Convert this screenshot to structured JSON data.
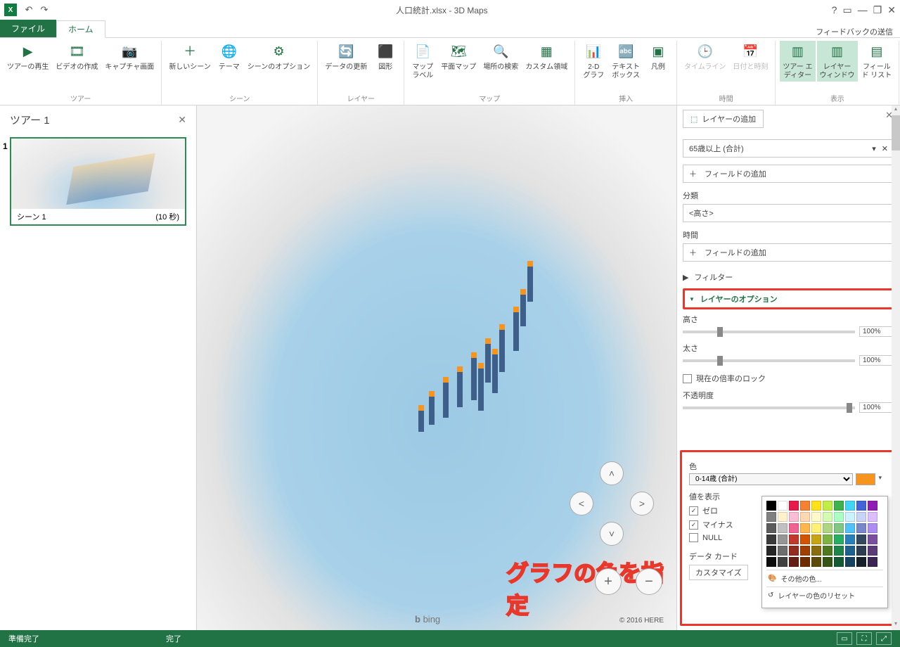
{
  "title": "人口統計.xlsx - 3D Maps",
  "qat": {
    "undo": "↶",
    "redo": "↷"
  },
  "winctrls": {
    "help": "?",
    "opts": "▭",
    "min": "—",
    "restore": "❐",
    "close": "✕"
  },
  "tabs": {
    "file": "ファイル",
    "home": "ホーム"
  },
  "feedback": "フィードバックの送信",
  "ribbon": {
    "tour": {
      "label": "ツアー",
      "play": "ツアーの再生",
      "video": "ビデオの作成",
      "capture": "キャプチャ画面"
    },
    "scene": {
      "label": "シーン",
      "newscene": "新しいシーン",
      "theme": "テーマ",
      "options": "シーンのオプション"
    },
    "layer": {
      "label": "レイヤー",
      "refresh": "データの更新",
      "shape": "図形"
    },
    "map": {
      "label": "マップ",
      "labels": "マップ\nラベル",
      "flat": "平面マップ",
      "find": "場所の検索",
      "custom": "カスタム領域"
    },
    "insert": {
      "label": "挿入",
      "chart2d": "2-D\nグラフ",
      "textbox": "テキスト\nボックス",
      "legend": "凡例"
    },
    "time": {
      "label": "時間",
      "timeline": "タイムライン",
      "datetime": "日付と時刻"
    },
    "view": {
      "label": "表示",
      "toureditor": "ツアー エ\nディター",
      "layerwin": "レイヤー\nウィンドウ",
      "fieldlist": "フィール\nド リスト"
    }
  },
  "tourpanel": {
    "title": "ツアー 1",
    "scene_idx": "1",
    "scene_name": "シーン 1",
    "scene_dur": "(10 秒)"
  },
  "map": {
    "bing": "bing",
    "copyright": "© 2016 HERE"
  },
  "callout": "グラフの色を指定",
  "side": {
    "add_layer": "レイヤーの追加",
    "height_field": "65歳以上 (合計)",
    "add_field": "フィールドの追加",
    "category": "分類",
    "category_val": "<高さ>",
    "time": "時間",
    "filter": "フィルター",
    "layer_opts": "レイヤーのオプション",
    "height": "高さ",
    "height_val": "100%",
    "thickness": "太さ",
    "thickness_val": "100%",
    "lockscale": "現在の倍率のロック",
    "opacity": "不透明度",
    "opacity_val": "100%",
    "color": "色",
    "color_field": "0-14歳 (合計)",
    "show_values": "値を表示",
    "zero": "ゼロ",
    "negative": "マイナス",
    "null": "NULL",
    "datacard": "データ カード",
    "customize": "カスタマイズ",
    "more_colors": "その他の色...",
    "reset_colors": "レイヤーの色のリセット"
  },
  "palette": [
    "#000000",
    "#ffffff",
    "#e6194B",
    "#f58231",
    "#ffe119",
    "#bfef45",
    "#3cb44b",
    "#42d4f4",
    "#4363d8",
    "#911eb4",
    "#808080",
    "#fff2cc",
    "#fabed4",
    "#ffd8b1",
    "#fffac8",
    "#d4fcb1",
    "#aaffc3",
    "#ccf2ff",
    "#c8d4f5",
    "#dcbeff",
    "#5c5c5c",
    "#c0c0c0",
    "#f06292",
    "#ffb74d",
    "#fff176",
    "#aed581",
    "#81c784",
    "#4fc3f7",
    "#7986cb",
    "#ab8cf0",
    "#3a3a3a",
    "#969696",
    "#c0392b",
    "#d35400",
    "#c8a415",
    "#7cb342",
    "#27ae60",
    "#2980b9",
    "#34495e",
    "#7b4fa0",
    "#262626",
    "#6e6e6e",
    "#922b21",
    "#a04000",
    "#8a6d10",
    "#4e7a1f",
    "#1e8449",
    "#1f618d",
    "#2c3e50",
    "#5b3b78",
    "#0d0d0d",
    "#404040",
    "#641e16",
    "#6e2c00",
    "#5c4a0b",
    "#365414",
    "#145a32",
    "#154360",
    "#17202a",
    "#3b2552"
  ],
  "status": {
    "ready": "準備完了",
    "done": "完了"
  }
}
